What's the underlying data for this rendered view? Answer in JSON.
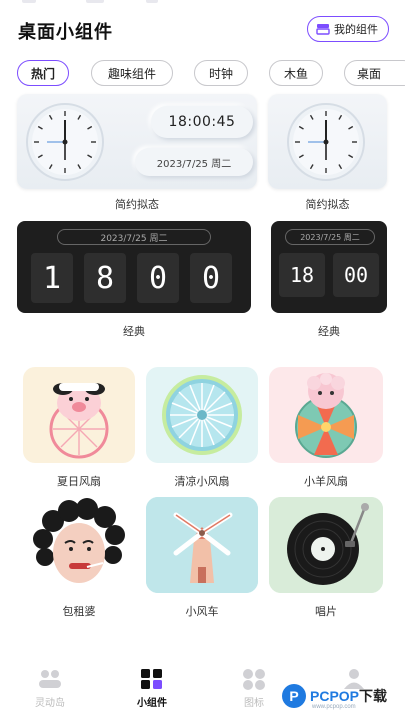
{
  "header": {
    "title": "桌面小组件",
    "my_widgets_label": "我的组件"
  },
  "tabs": [
    {
      "label": "热门",
      "active": true
    },
    {
      "label": "趣味组件",
      "active": false
    },
    {
      "label": "时钟",
      "active": false
    },
    {
      "label": "木鱼",
      "active": false
    },
    {
      "label": "桌面",
      "active": false
    }
  ],
  "widgets": {
    "neumorphic_large": {
      "time": "18:00:45",
      "date": "2023/7/25 周二",
      "label": "简约拟态"
    },
    "neumorphic_small": {
      "label": "简约拟态"
    },
    "flip_large": {
      "date": "2023/7/25 周二",
      "digits": [
        "1",
        "8",
        "0",
        "0"
      ],
      "label": "经典"
    },
    "flip_small": {
      "date": "2023/7/25 周二",
      "digits": [
        "18",
        "00"
      ],
      "label": "经典"
    }
  },
  "fun_widgets": [
    {
      "label": "夏日风扇",
      "icon": "pig-fan-icon"
    },
    {
      "label": "清凉小风扇",
      "icon": "blue-fan-icon"
    },
    {
      "label": "小羊风扇",
      "icon": "sheep-fan-icon"
    },
    {
      "label": "包租婆",
      "icon": "landlady-icon"
    },
    {
      "label": "小风车",
      "icon": "windmill-icon"
    },
    {
      "label": "唱片",
      "icon": "vinyl-record-icon"
    }
  ],
  "bottom_nav": [
    {
      "label": "灵动岛",
      "icon": "island-icon",
      "active": false
    },
    {
      "label": "小组件",
      "icon": "widgets-icon",
      "active": true
    },
    {
      "label": "图标",
      "icon": "icons-icon",
      "active": false
    },
    {
      "label": "",
      "icon": "profile-icon",
      "active": false
    }
  ],
  "watermark": {
    "brand_p": "P",
    "brand_main": "PCPOP",
    "brand_suffix": "下载",
    "sub": "www.pcpop.com"
  },
  "colors": {
    "accent": "#7c4dff",
    "dark_card": "#1e1e1e",
    "watermark_blue": "#1f7ae0"
  }
}
